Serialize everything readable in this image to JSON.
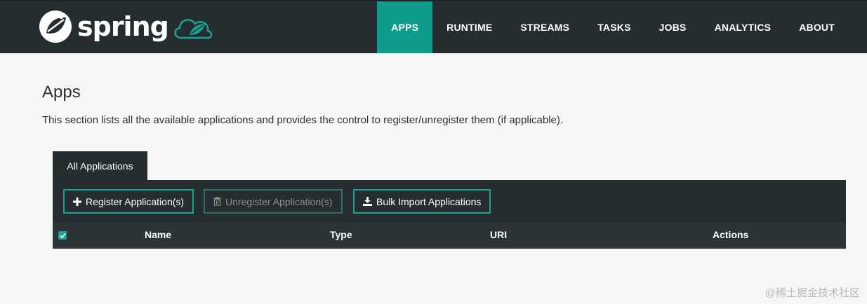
{
  "brand": {
    "name": "spring"
  },
  "nav": {
    "items": [
      {
        "label": "APPS",
        "active": true
      },
      {
        "label": "RUNTIME",
        "active": false
      },
      {
        "label": "STREAMS",
        "active": false
      },
      {
        "label": "TASKS",
        "active": false
      },
      {
        "label": "JOBS",
        "active": false
      },
      {
        "label": "ANALYTICS",
        "active": false
      },
      {
        "label": "ABOUT",
        "active": false
      }
    ]
  },
  "page": {
    "title": "Apps",
    "description": "This section lists all the available applications and provides the control to register/unregister them (if applicable)."
  },
  "tabs": [
    {
      "label": "All Applications",
      "active": true
    }
  ],
  "toolbar": {
    "register_label": "Register Application(s)",
    "unregister_label": "Unregister Application(s)",
    "bulk_import_label": "Bulk Import Applications"
  },
  "table": {
    "columns": [
      "Name",
      "Type",
      "URI",
      "Actions"
    ],
    "select_all_checked": true,
    "rows": []
  },
  "watermark": "@稀土掘金技术社区",
  "colors": {
    "navbar": "#262d31",
    "accent": "#0d9c8c",
    "button_border": "#1aa394",
    "background": "#f6f6f6"
  }
}
